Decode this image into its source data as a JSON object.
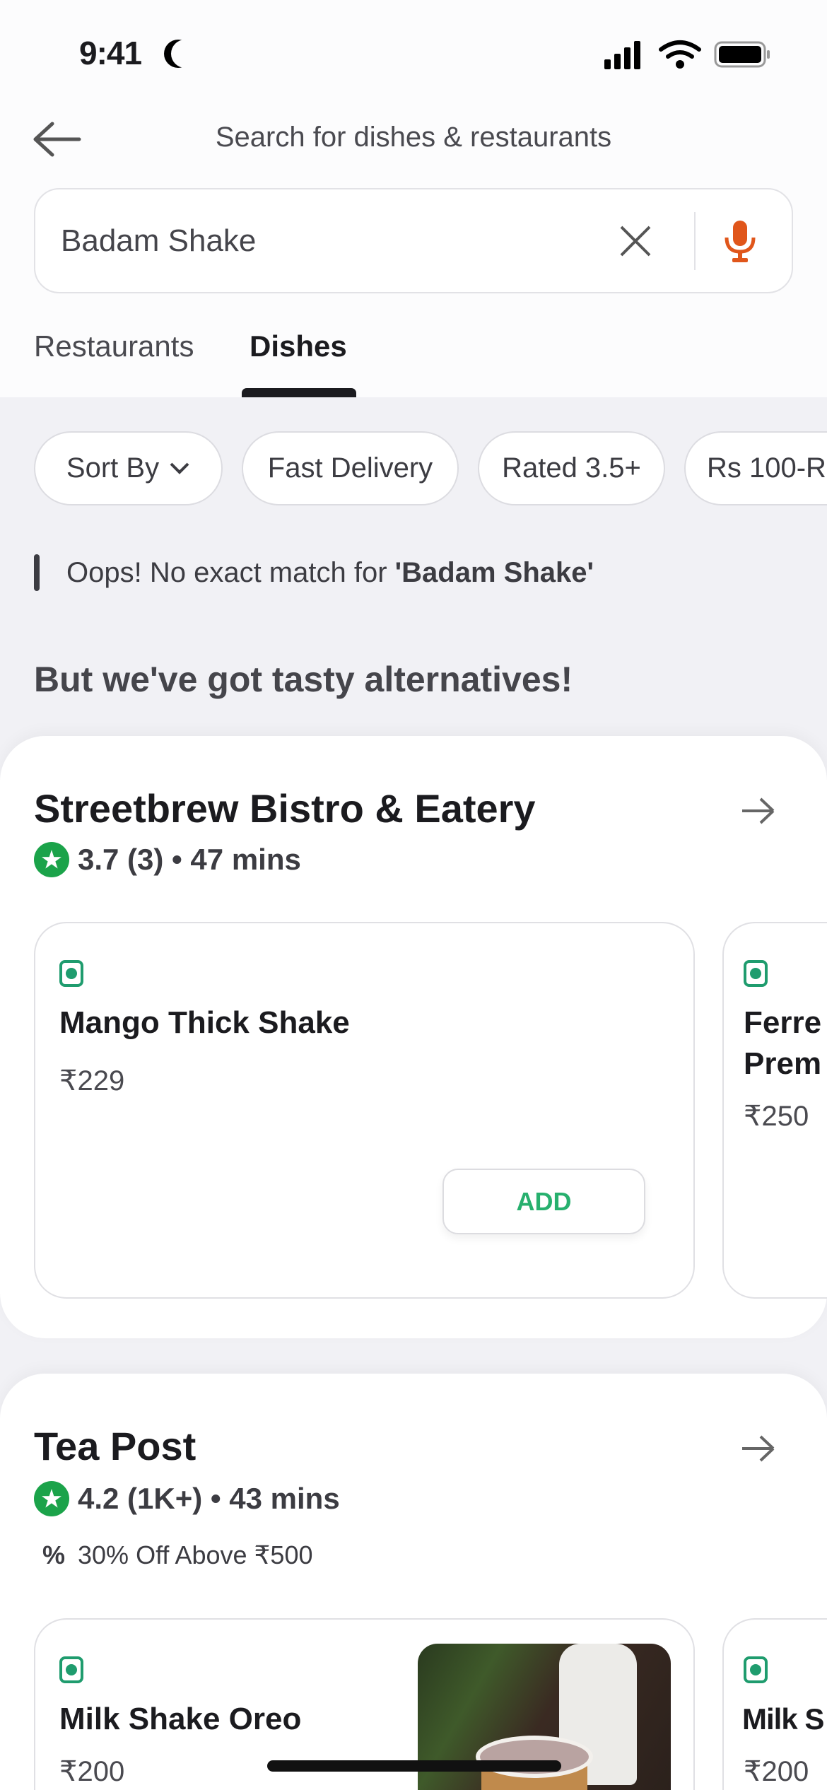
{
  "status": {
    "time": "9:41"
  },
  "header": {
    "title": "Search for dishes & restaurants"
  },
  "search": {
    "value": "Badam Shake"
  },
  "tabs": [
    {
      "label": "Restaurants",
      "active": false
    },
    {
      "label": "Dishes",
      "active": true
    }
  ],
  "filters": [
    "Sort By",
    "Fast Delivery",
    "Rated 3.5+",
    "Rs 100-R"
  ],
  "notice": {
    "prefix": "Oops! No exact match for ",
    "query": "'Badam Shake'"
  },
  "section_title": "But we've got tasty alternatives!",
  "colors": {
    "accent_green": "#1f9c6e",
    "rating_green": "#1ba34a",
    "mic": "#e0561b",
    "add": "#27b06e"
  },
  "restaurants": [
    {
      "name": "Streetbrew Bistro & Eatery",
      "rating": "3.7 (3) • 47 mins",
      "dishes": [
        {
          "name": "Mango Thick Shake",
          "price": "₹229",
          "add": "ADD"
        },
        {
          "name": "Ferre Prem",
          "price": "₹250"
        }
      ]
    },
    {
      "name": "Tea Post",
      "rating": "4.2 (1K+) • 43 mins",
      "offer": "30% Off Above ₹500",
      "dishes": [
        {
          "name": "Milk Shake Oreo",
          "price": "₹200"
        },
        {
          "name": "Milk S",
          "price": "₹200"
        }
      ]
    }
  ]
}
